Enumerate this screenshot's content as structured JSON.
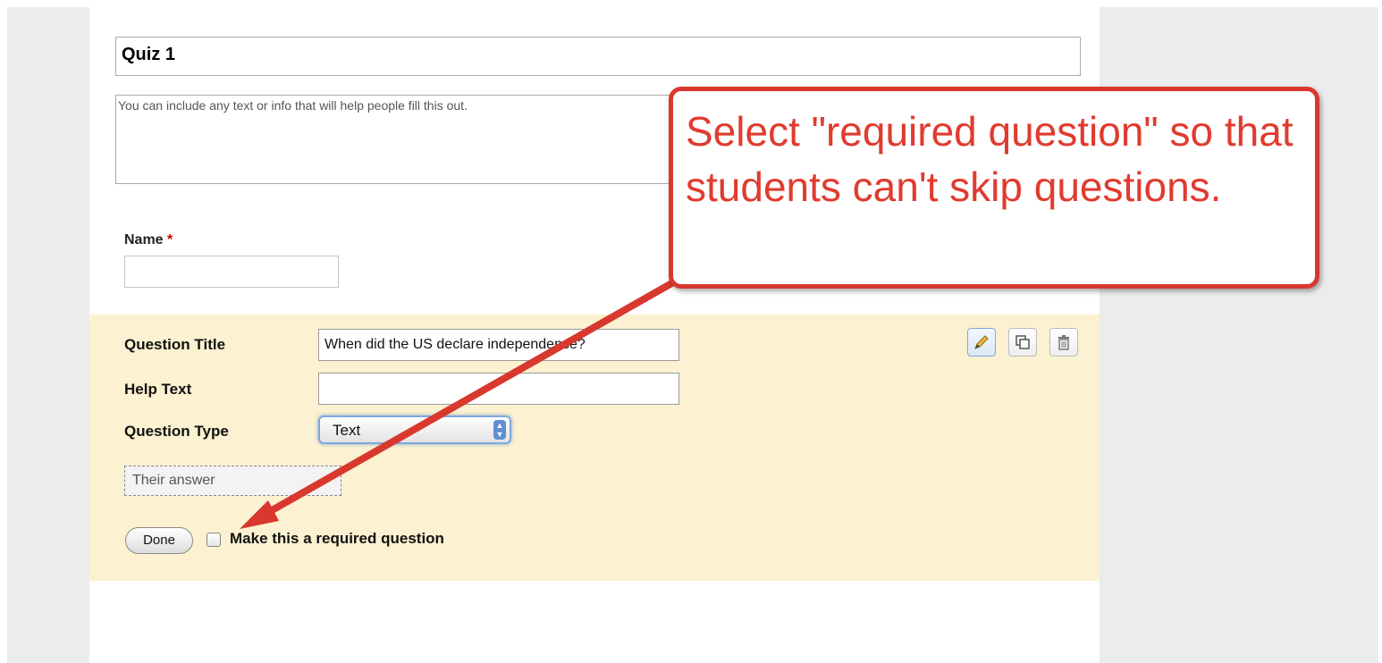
{
  "form": {
    "title": "Quiz 1",
    "description_placeholder": "You can include any text or info that will help people fill this out."
  },
  "name_question": {
    "label": "Name",
    "required_marker": "*"
  },
  "question_editor": {
    "title_label": "Question Title",
    "title_value": "When did the US declare independence?",
    "help_label": "Help Text",
    "help_value": "",
    "type_label": "Question Type",
    "type_value": "Text",
    "answer_preview": "Their answer",
    "done_label": "Done",
    "required_label": "Make this a required question",
    "required_checked": false
  },
  "toolbar": {
    "icons": [
      "pencil-icon",
      "duplicate-icon",
      "trash-icon"
    ]
  },
  "callout": {
    "text": "Select \"required question\" so that students can't skip questions."
  },
  "colors": {
    "edit_area_bg": "#fcf1d0",
    "callout_red": "#e03b2f",
    "required_star": "#cc0000"
  }
}
